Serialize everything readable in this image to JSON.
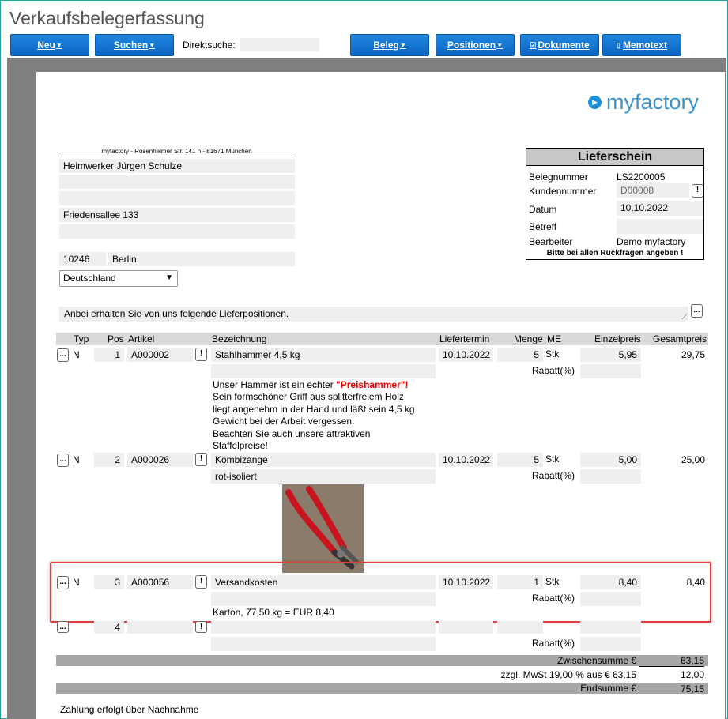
{
  "app": {
    "title": "Verkaufsbelegerfassung"
  },
  "toolbar": {
    "neu": "Neu",
    "suchen": "Suchen",
    "direktsuche_label": "Direktsuche:",
    "direktsuche_value": "",
    "beleg": "Beleg",
    "positionen": "Positionen",
    "dokumente": "Dokumente",
    "memotext": "Memotext"
  },
  "logo": {
    "text": "myfactory"
  },
  "address": {
    "sender": "myfactory - Rosenheimer Str. 141 h - 81671 München",
    "line1": "Heimwerker Jürgen Schulze",
    "line2": "",
    "line3": "",
    "street": "Friedensallee 133",
    "line5": "",
    "zip": "10246",
    "city": "Berlin",
    "country": "Deutschland"
  },
  "doc": {
    "heading": "Lieferschein",
    "belegnummer_label": "Belegnummer",
    "belegnummer": "LS2200005",
    "kundennummer_label": "Kundennummer",
    "kundennummer": "D00008",
    "datum_label": "Datum",
    "datum": "10.10.2022",
    "betreff_label": "Betreff",
    "betreff": "",
    "bearbeiter_label": "Bearbeiter",
    "bearbeiter": "Demo myfactory",
    "note": "Bitte bei allen Rückfragen angeben !"
  },
  "intro": "Anbei erhalten Sie von uns folgende Lieferpositionen.",
  "columns": {
    "typ": "Typ",
    "pos": "Pos",
    "artikel": "Artikel",
    "bezeichnung": "Bezeichnung",
    "liefertermin": "Liefertermin",
    "menge": "Menge",
    "me": "ME",
    "einzelpreis": "Einzelpreis",
    "gesamtpreis": "Gesamtpreis"
  },
  "rabatt_label": "Rabatt(%)",
  "positions": [
    {
      "typ": "N",
      "pos": "1",
      "artikel": "A000002",
      "bezeichnung": "Stahlhammer 4,5 kg",
      "bez2": "",
      "termin": "10.10.2022",
      "menge": "5",
      "me": "Stk",
      "einzel": "5,95",
      "gesamt": "29,75",
      "desc_pre": "Unser Hammer ist ein echter ",
      "desc_red": "\"Preishammer\"!",
      "desc_lines": [
        "Sein formschöner Griff aus splitterfreiem Holz",
        "liegt angenehm in der Hand und läßt sein 4,5 kg",
        "Gewicht bei der Arbeit vergessen.",
        "Beachten Sie auch unsere attraktiven",
        "Staffelpreise!"
      ]
    },
    {
      "typ": "N",
      "pos": "2",
      "artikel": "A000026",
      "bezeichnung": "Kombizange",
      "bez2": "rot-isoliert",
      "termin": "10.10.2022",
      "menge": "5",
      "me": "Stk",
      "einzel": "5,00",
      "gesamt": "25,00"
    },
    {
      "typ": "N",
      "pos": "3",
      "artikel": "A000056",
      "bezeichnung": "Versandkosten",
      "bez2": "",
      "termin": "10.10.2022",
      "menge": "1",
      "me": "Stk",
      "einzel": "8,40",
      "gesamt": "8,40",
      "desc": "Karton, 77,50 kg = EUR 8,40"
    },
    {
      "typ": "",
      "pos": "4",
      "artikel": "",
      "bezeichnung": "",
      "bez2": "",
      "termin": "",
      "menge": "",
      "me": "",
      "einzel": "",
      "gesamt": ""
    }
  ],
  "totals": {
    "zwischensumme_label": "Zwischensumme €",
    "zwischensumme": "63,15",
    "mwst_label": "zzgl. MwSt 19,00 % aus € 63,15",
    "mwst": "12,00",
    "endsumme_label": "Endsumme €",
    "endsumme": "75,15"
  },
  "payment": "Zahlung erfolgt über Nachnahme"
}
